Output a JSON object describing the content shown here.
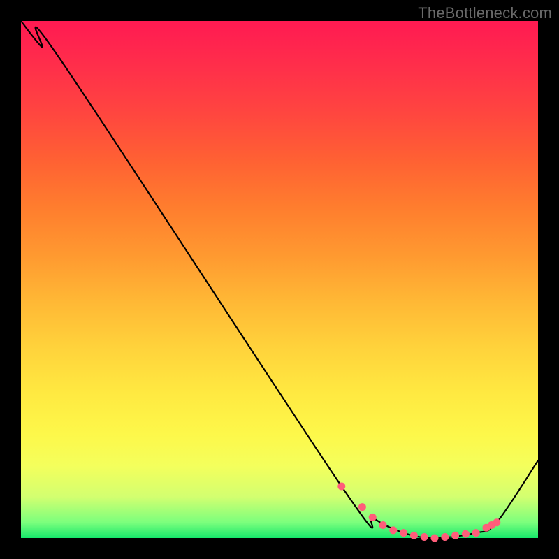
{
  "watermark": "TheBottleneck.com",
  "chart_data": {
    "type": "line",
    "title": "",
    "xlabel": "",
    "ylabel": "",
    "xlim": [
      0,
      100
    ],
    "ylim": [
      0,
      100
    ],
    "series": [
      {
        "name": "curve",
        "x": [
          0,
          4,
          8,
          62,
          68,
          74,
          80,
          88,
          92,
          100
        ],
        "values": [
          100,
          95,
          92,
          10,
          4,
          1,
          0,
          1,
          3,
          15
        ]
      }
    ],
    "markers": {
      "name": "highlight-dots",
      "color": "#ff5d7a",
      "x": [
        62,
        66,
        68,
        70,
        72,
        74,
        76,
        78,
        80,
        82,
        84,
        86,
        88,
        90,
        91,
        92
      ],
      "values": [
        10,
        6,
        4,
        2.5,
        1.5,
        1,
        0.5,
        0.2,
        0,
        0.2,
        0.5,
        0.8,
        1,
        2,
        2.5,
        3
      ]
    }
  }
}
